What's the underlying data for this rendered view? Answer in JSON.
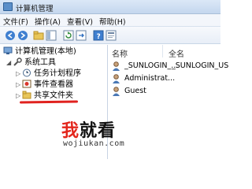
{
  "window": {
    "title": "计算机管理"
  },
  "menu": {
    "items": [
      "文件(F)",
      "操作(A)",
      "查看(V)",
      "帮助(H)"
    ]
  },
  "toolbar": {
    "buttons": [
      "back-arrow-icon",
      "forward-arrow-icon",
      "up-folder-icon",
      "show-tree-icon",
      "refresh-icon",
      "export-icon",
      "help-icon",
      "properties-icon"
    ]
  },
  "tree": {
    "root": "计算机管理(本地)",
    "system_tools": "系统工具",
    "items": [
      "任务计划程序",
      "事件查看器",
      "共享文件夹"
    ]
  },
  "list": {
    "columns": [
      "名称",
      "全名"
    ],
    "rows": [
      {
        "name": "_SUNLOGIN_...",
        "full": "_SUNLOGIN_US"
      },
      {
        "name": "Administrat...",
        "full": ""
      },
      {
        "name": "Guest",
        "full": ""
      }
    ]
  },
  "watermark": {
    "part1": "我",
    "part2": "就看",
    "url": "wojiukan.com"
  },
  "colors": {
    "highlight_underline": "#e0221f",
    "watermark_red": "#e3261c"
  }
}
